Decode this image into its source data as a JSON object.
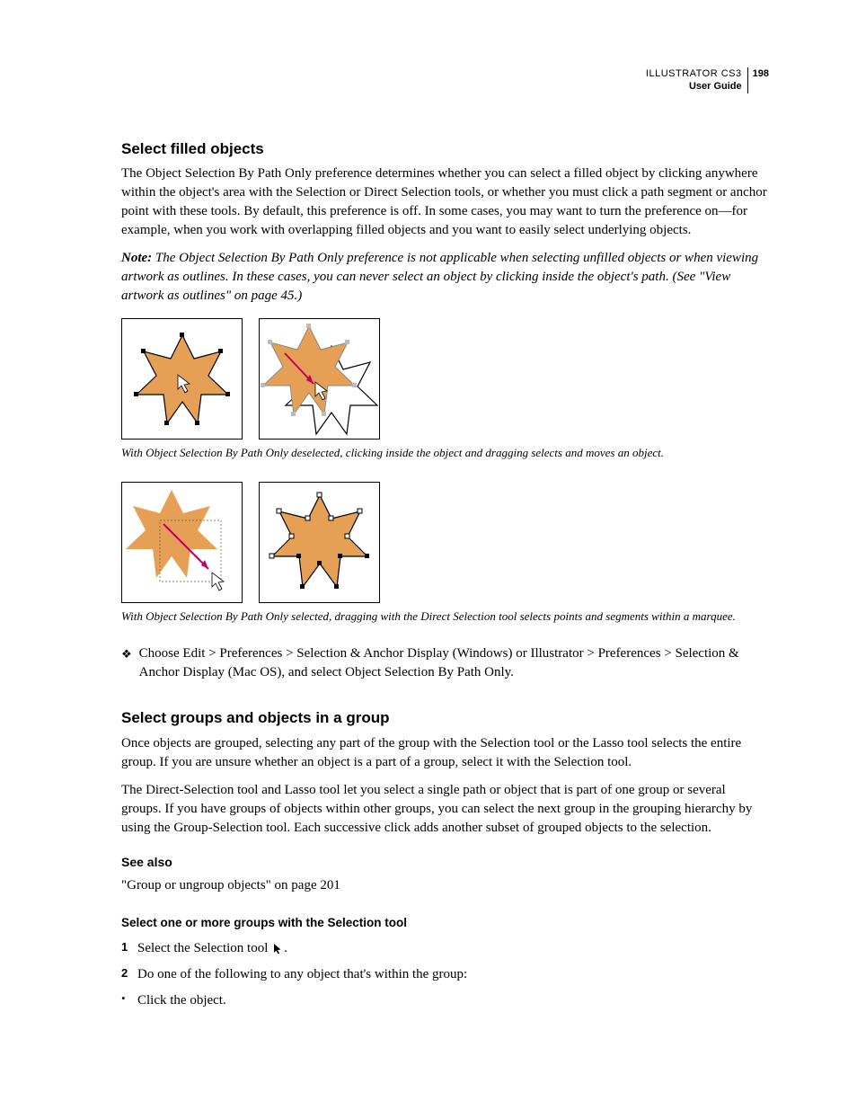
{
  "header": {
    "title": "ILLUSTRATOR CS3",
    "subtitle": "User Guide",
    "page_number": "198"
  },
  "section1": {
    "heading": "Select filled objects",
    "para1": "The Object Selection By Path Only preference determines whether you can select a filled object by clicking anywhere within the object's area with the Selection or Direct Selection tools, or whether you must click a path segment or anchor point with these tools. By default, this preference is off. In some cases, you may want to turn the preference on—for example, when you work with overlapping filled objects and you want to easily select underlying objects.",
    "note_label": "Note:",
    "note_text": " The Object Selection By Path Only preference is not applicable when selecting unfilled objects or when viewing artwork as outlines. In these cases, you can never select an object by clicking inside the object's path. (See \"View artwork as outlines\" on page 45.)",
    "caption1": "With Object Selection By Path Only deselected, clicking inside the object and dragging selects and moves an object.",
    "caption2": "With Object Selection By Path Only selected, dragging with the Direct Selection tool selects points and segments within a marquee.",
    "step_text": "Choose Edit > Preferences > Selection & Anchor Display (Windows) or Illustrator > Preferences > Selection & Anchor Display (Mac OS), and select Object Selection By Path Only."
  },
  "section2": {
    "heading": "Select groups and objects in a group",
    "para1": "Once objects are grouped, selecting any part of the group with the Selection tool or the Lasso tool selects the entire group. If you are unsure whether an object is a part of a group, select it with the Selection tool.",
    "para2": "The Direct-Selection tool and Lasso tool let you select a single path or object that is part of one group or several groups. If you have groups of objects within other groups, you can select the next group in the grouping hierarchy by using the Group-Selection tool. Each successive click adds another subset of grouped objects to the selection.",
    "see_also_heading": "See also",
    "see_also_text": "\"Group or ungroup objects\" on page 201",
    "sub_heading": "Select one or more groups with the Selection tool",
    "step1_num": "1",
    "step1_text_a": "Select the Selection tool ",
    "step1_text_b": ".",
    "step2_num": "2",
    "step2_text": "Do one of the following to any object that's within the group:",
    "bullet1": "Click the object."
  }
}
